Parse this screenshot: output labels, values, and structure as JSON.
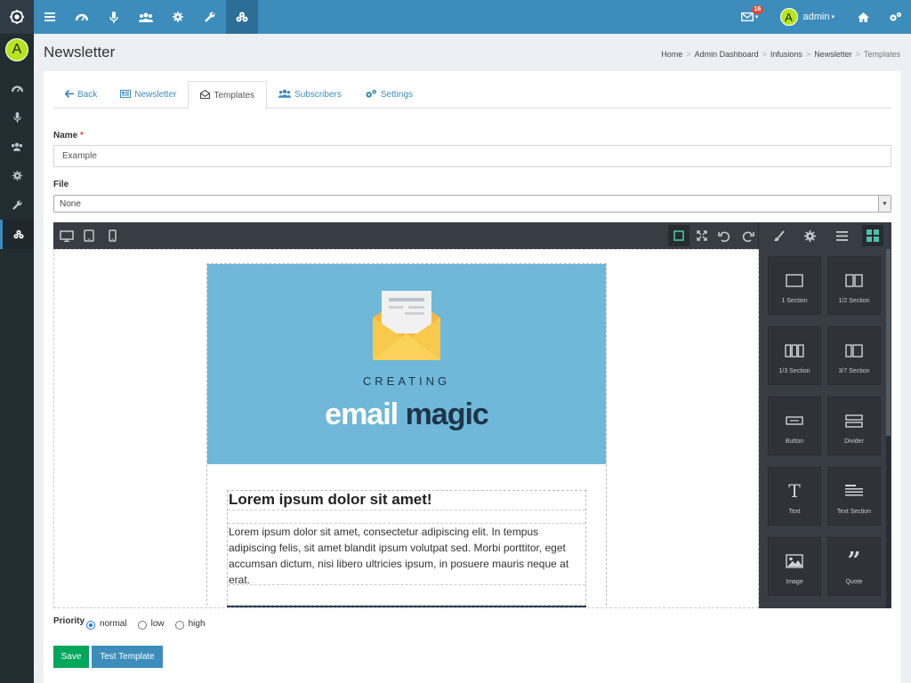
{
  "header": {
    "title": "Newsletter"
  },
  "topbar": {
    "notification_count": "16",
    "user": {
      "initial": "A",
      "name": "admin"
    }
  },
  "sidebar": {
    "avatar_initial": "A"
  },
  "breadcrumb": [
    "Home",
    "Admin Dashboard",
    "Infusions",
    "Newsletter",
    "Templates"
  ],
  "tabs": [
    {
      "label": "Back",
      "icon": "arrow-left-icon"
    },
    {
      "label": "Newsletter",
      "icon": "newspaper-icon"
    },
    {
      "label": "Templates",
      "icon": "envelope-open-icon",
      "active": true
    },
    {
      "label": "Subscribers",
      "icon": "users-icon"
    },
    {
      "label": "Settings",
      "icon": "gears-icon"
    }
  ],
  "form": {
    "name_label": "Name",
    "name_required": "*",
    "name_value": "Example",
    "file_label": "File",
    "file_value": "None",
    "priority_label": "Priority",
    "priority_options": [
      "normal",
      "low",
      "high"
    ],
    "priority_selected": "normal",
    "save_label": "Save",
    "test_label": "Test Template"
  },
  "editor": {
    "hero": {
      "line1": "CREATING",
      "word1": "email",
      "word2": "magic"
    },
    "content_title": "Lorem ipsum dolor sit amet!",
    "content_body": "Lorem ipsum dolor sit amet, consectetur adipiscing elit. In tempus adipiscing felis, sit amet blandit ipsum volutpat sed. Morbi porttitor, eget accumsan dictum, nisi libero ultricies ipsum, in posuere mauris neque at erat.",
    "blocks": [
      {
        "label": "1 Section"
      },
      {
        "label": "1/2 Section"
      },
      {
        "label": "1/3 Section"
      },
      {
        "label": "3/7 Section"
      },
      {
        "label": "Button"
      },
      {
        "label": "Divider"
      },
      {
        "label": "Text"
      },
      {
        "label": "Text Section"
      },
      {
        "label": "Image"
      },
      {
        "label": "Quote"
      }
    ]
  },
  "colors": {
    "brand": "#3c8dbc",
    "save": "#00a65a",
    "hero": "#6fb8d9",
    "accent": "#4bc0a8"
  }
}
